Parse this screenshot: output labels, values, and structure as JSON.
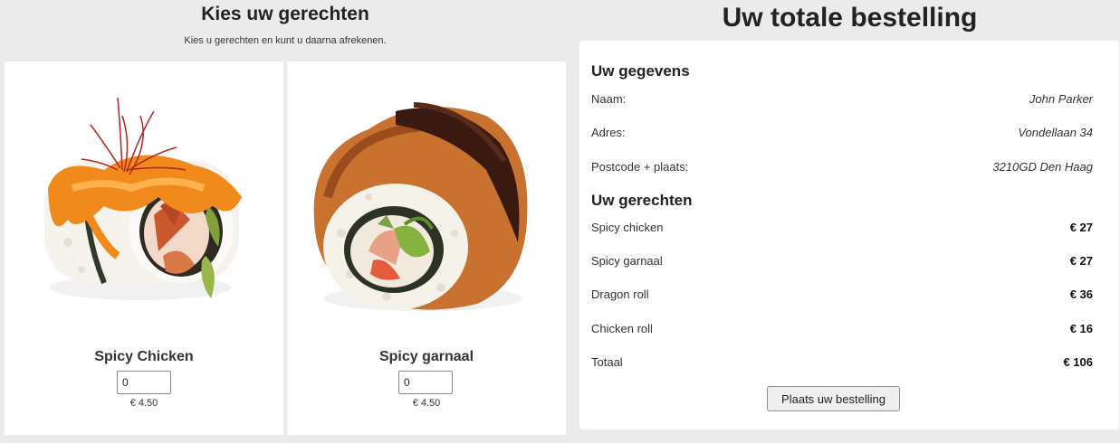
{
  "menu": {
    "title": "Kies uw gerechten",
    "subtitle": "Kies u gerechten en kunt u daarna afrekenen.",
    "items": [
      {
        "name": "Spicy Chicken",
        "qty": "0",
        "price": "€ 4.50"
      },
      {
        "name": "Spicy garnaal",
        "qty": "0",
        "price": "€ 4.50"
      }
    ]
  },
  "order": {
    "title": "Uw totale bestelling",
    "details_heading": "Uw gegevens",
    "details": [
      {
        "label": "Naam:",
        "value": "John Parker"
      },
      {
        "label": "Adres:",
        "value": "Vondellaan 34"
      },
      {
        "label": "Postcode + plaats:",
        "value": "3210GD Den Haag"
      }
    ],
    "dishes_heading": "Uw gerechten",
    "dishes": [
      {
        "label": "Spicy chicken",
        "value": "€ 27"
      },
      {
        "label": "Spicy garnaal",
        "value": "€ 27"
      },
      {
        "label": "Dragon roll",
        "value": "€ 36"
      },
      {
        "label": "Chicken roll",
        "value": "€ 16"
      }
    ],
    "total": {
      "label": "Totaal",
      "value": "€ 106"
    },
    "button_label": "Plaats uw bestelling"
  }
}
